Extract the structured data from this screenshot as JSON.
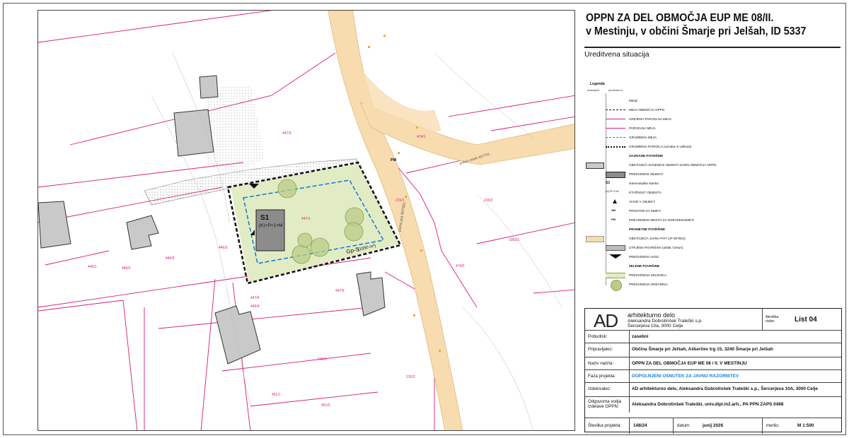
{
  "project": {
    "title_line1": "OPPN ZA DEL OBMOČJA EUP ME 08/II.",
    "title_line2": "v Mestinju, v občini Šmarje pri Jelšah, ID 5337",
    "subtitle": "Ureditvena situacija"
  },
  "legend": {
    "heading": "Legenda",
    "col_existing": "obstoječe",
    "col_planned": "predvideno",
    "items": [
      {
        "label": "MEJE",
        "bold": false,
        "symbol": "none"
      },
      {
        "label": "MEJA OBMOČJA OPPN",
        "bold": false,
        "symbol": "dash-black"
      },
      {
        "label": "UREJENA PARCELNA MEJA",
        "bold": false,
        "symbol": "line-magenta"
      },
      {
        "label": "PARCELNA MEJA",
        "bold": false,
        "symbol": "line-magenta"
      },
      {
        "label": "GRADBENA MEJA",
        "bold": false,
        "symbol": "dash-blue"
      },
      {
        "label": "GRADBENA PARCELA (oznaka in velikost)",
        "bold": false,
        "symbol": "dash-black-bold"
      },
      {
        "label": "ZAZIDANE POVRŠINE",
        "bold": true,
        "symbol": "none"
      },
      {
        "label": "OBSTOJEČI SOSEDNJI OBJEKTI IZVEN OBMOČJA OPPN",
        "bold": false,
        "symbol": "grey-box"
      },
      {
        "label": "PREDVIDENI OBJEKTI",
        "bold": false,
        "symbol": "dark-box"
      },
      {
        "label": "stanovanjska stavba",
        "bold": false,
        "symbol": "text-s1"
      },
      {
        "label": "ETAŽNOST OBJEKTA",
        "bold": false,
        "symbol": "text-etaz"
      },
      {
        "label": "VHOD V OBJEKT",
        "bold": false,
        "symbol": "triangle"
      },
      {
        "label": "PROSTOR ZA SMETI",
        "bold": false,
        "symbol": "text-sm"
      },
      {
        "label": "PREVZEMNO MESTO ZA ODPADKE/SMETI",
        "bold": false,
        "symbol": "text-pm"
      },
      {
        "label": "PROMETNE POVRŠINE",
        "bold": true,
        "symbol": "none"
      },
      {
        "label": "OBSTOJEČA JAVNA POT (JP 907951)",
        "bold": false,
        "symbol": "road-box"
      },
      {
        "label": "UTRJENA POVRŠINA (asfalt / beton)",
        "bold": false,
        "symbol": "paved"
      },
      {
        "label": "PREDVIDENI UVOZ",
        "bold": false,
        "symbol": "arrow-down"
      },
      {
        "label": "ZELENE POVRŠINE",
        "bold": true,
        "symbol": "none"
      },
      {
        "label": "PREDVIDENA ZELENICA",
        "bold": false,
        "symbol": "green-box"
      },
      {
        "label": "PREDVIDENA DREVNINA",
        "bold": false,
        "symbol": "tree"
      }
    ]
  },
  "stamp": {
    "company_logo": "AD",
    "company_name": "arhitekturno delo",
    "company_line2": "Aleksandra Dobrotinšek Trateški s.p.",
    "company_line3": "Šercerjeva 10a, 3000 Celje",
    "sheet_label": "številka risbe:",
    "sheet_value": "List 04",
    "rows": [
      {
        "label": "Pobudnik:",
        "value": "zasebni"
      },
      {
        "label": "Pripravljalec:",
        "value": "Občina Šmarje pri Jelšah, Aškerčev trg 15, 3240 Šmarje pri Jelšah"
      },
      {
        "label": "Naziv načrta:",
        "value": "OPPN ZA DEL OBMOČJA EUP ME 08 / II. V MESTINJU"
      },
      {
        "label": "Faza projekta:",
        "value": "DOPOLNJENI OSNUTEK ZA JAVNO RAZGRNITEV"
      },
      {
        "label": "Izdelovalec:",
        "value": "AD arhitekturno delo, Aleksandra Dobrotinšek Trateški s.p., Šercerjeva 10A, 3000 Celje"
      },
      {
        "label": "Odgovorna vodja izdelave OPPN:",
        "value": "Aleksandra Dobrotinšek Trateški, univ.dipl.inž.arh., PA PPN ZAPS 0498"
      }
    ],
    "footer": {
      "number_label": "Številka projekta:",
      "number_value": "148/24",
      "date_label": "datum:",
      "date_value": "junij 2026",
      "scale_label": "merilo:",
      "scale_value": "M 1:500"
    }
  },
  "map": {
    "building_label": "S1",
    "building_floors": "(K)+P+1+M",
    "plot_label": "Gp-S",
    "plot_area": "(1550 m²)",
    "pm_label": "PM",
    "road_label_vertical": "javna pot 907951",
    "road_label_right": "prikaz ceste 407751",
    "parcels": [
      "447/1",
      "447/4",
      "447/5",
      "446/3",
      "446/4",
      "446/5",
      "446/2",
      "446/1",
      "447/3",
      "1982/1",
      "474/1",
      "474/2",
      "215/3",
      "215/1",
      "215/2",
      "445/3",
      "451/1",
      "451/2"
    ],
    "colors": {
      "road": "#f7dcb0",
      "plot": "#e2ecc4",
      "building": "#8c8c8c",
      "neighbor": "#c9c9c9",
      "parcel": "#d81b7a",
      "buildline": "#1a7fd6"
    }
  }
}
